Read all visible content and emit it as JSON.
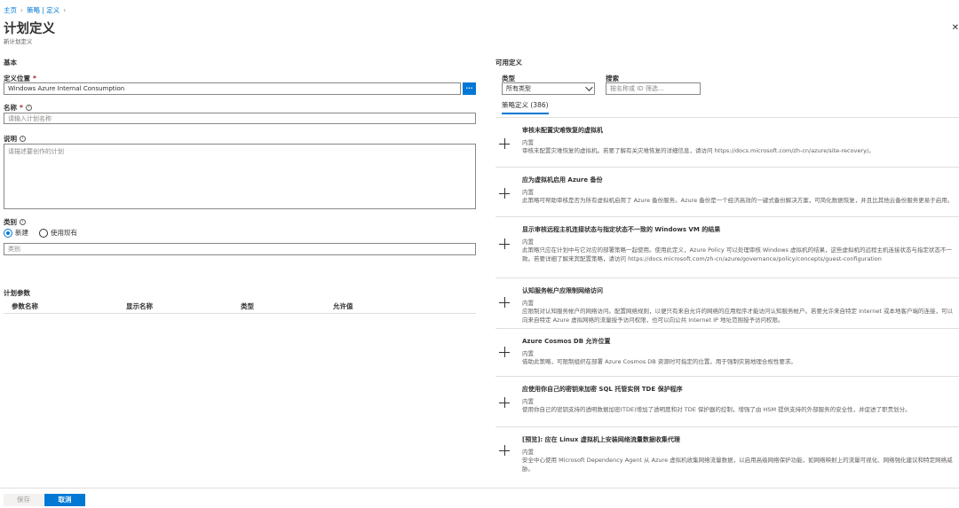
{
  "breadcrumb": {
    "home": "主页",
    "policy": "策略 | 定义"
  },
  "header": {
    "title": "计划定义",
    "subtitle": "新计划定义"
  },
  "basics": {
    "section_title": "基本",
    "location_label": "定义位置",
    "location_value": "Windows Azure Internal Consumption",
    "browse_label": "...",
    "name_label": "名称",
    "name_placeholder": "请输入计划名称",
    "description_label": "说明",
    "description_placeholder": "请描述要创作的计划",
    "category_label": "类别",
    "category_options": [
      "新建",
      "使用现有"
    ],
    "category_selected": "新建",
    "category_placeholder": "类别",
    "required_mark": "*"
  },
  "params": {
    "section_title": "计划参数",
    "columns": [
      "参数名称",
      "显示名称",
      "类型",
      "允许值"
    ]
  },
  "available": {
    "section_title": "可用定义",
    "type_label": "类型",
    "type_value": "所有类型",
    "search_label": "搜索",
    "search_placeholder": "按名称或 ID 筛选...",
    "tab_label": "策略定义 (386)",
    "policies": [
      {
        "title": "审核未配置灾难恢复的虚拟机",
        "type": "内置",
        "description": "审核未配置灾难恢复的虚拟机。若要了解有关灾难恢复的详细信息，请访问 https://docs.microsoft.com/zh-cn/azure/site-recovery/。"
      },
      {
        "title": "应为虚拟机启用 Azure 备份",
        "type": "内置",
        "description": "此策略可帮助审核是否为所有虚拟机启用了 Azure 备份服务。Azure 备份是一个经济高效的一键式备份解决方案，可简化数据恢复，并且比其他云备份服务更易于启用。"
      },
      {
        "title": "显示审核远程主机连接状态与指定状态不一致的 Windows VM 的结果",
        "type": "内置",
        "description": "此策略只应在计划中与它对应的部署策略一起使用。使用此定义，Azure Policy 可以处理审核 Windows 虚拟机的结果，这些虚拟机的远程主机连接状态与指定状态不一致。若要详细了解来宾配置策略，请访问 https://docs.microsoft.com/zh-cn/azure/governance/policy/concepts/guest-configuration"
      },
      {
        "title": "认知服务帐户应限制网络访问",
        "type": "内置",
        "description": "应限制对认知服务帐户的网络访问。配置网络规则，以便只有来自允许的网络的应用程序才能访问认知服务帐户。若要允许来自特定 Internet 或本地客户端的连接，可以向来自特定 Azure 虚拟网络的流量授予访问权限，也可以向公共 Internet IP 地址范围授予访问权限。"
      },
      {
        "title": "Azure Cosmos DB 允许位置",
        "type": "内置",
        "description": "借助此策略，可限制组织在部署 Azure Cosmos DB 资源时可指定的位置。用于强制实施地理合规性要求。"
      },
      {
        "title": "应使用你自己的密钥来加密 SQL 托管实例 TDE 保护程序",
        "type": "内置",
        "description": "使用你自己的密钥支持的透明数据加密(TDE)增加了透明度和对 TDE 保护器的控制，增强了由 HSM 提供支持的外部服务的安全性，并促进了职责划分。"
      },
      {
        "title": "[预览]: 应在 Linux 虚拟机上安装网络流量数据收集代理",
        "type": "内置",
        "description": "安全中心使用 Microsoft Dependency Agent 从 Azure 虚拟机收集网络流量数据，以启用高级网络保护功能，如网络映射上的流量可视化、网络强化建议和特定网络威胁。"
      }
    ]
  },
  "footer": {
    "save_label": "保存",
    "cancel_label": "取消"
  }
}
